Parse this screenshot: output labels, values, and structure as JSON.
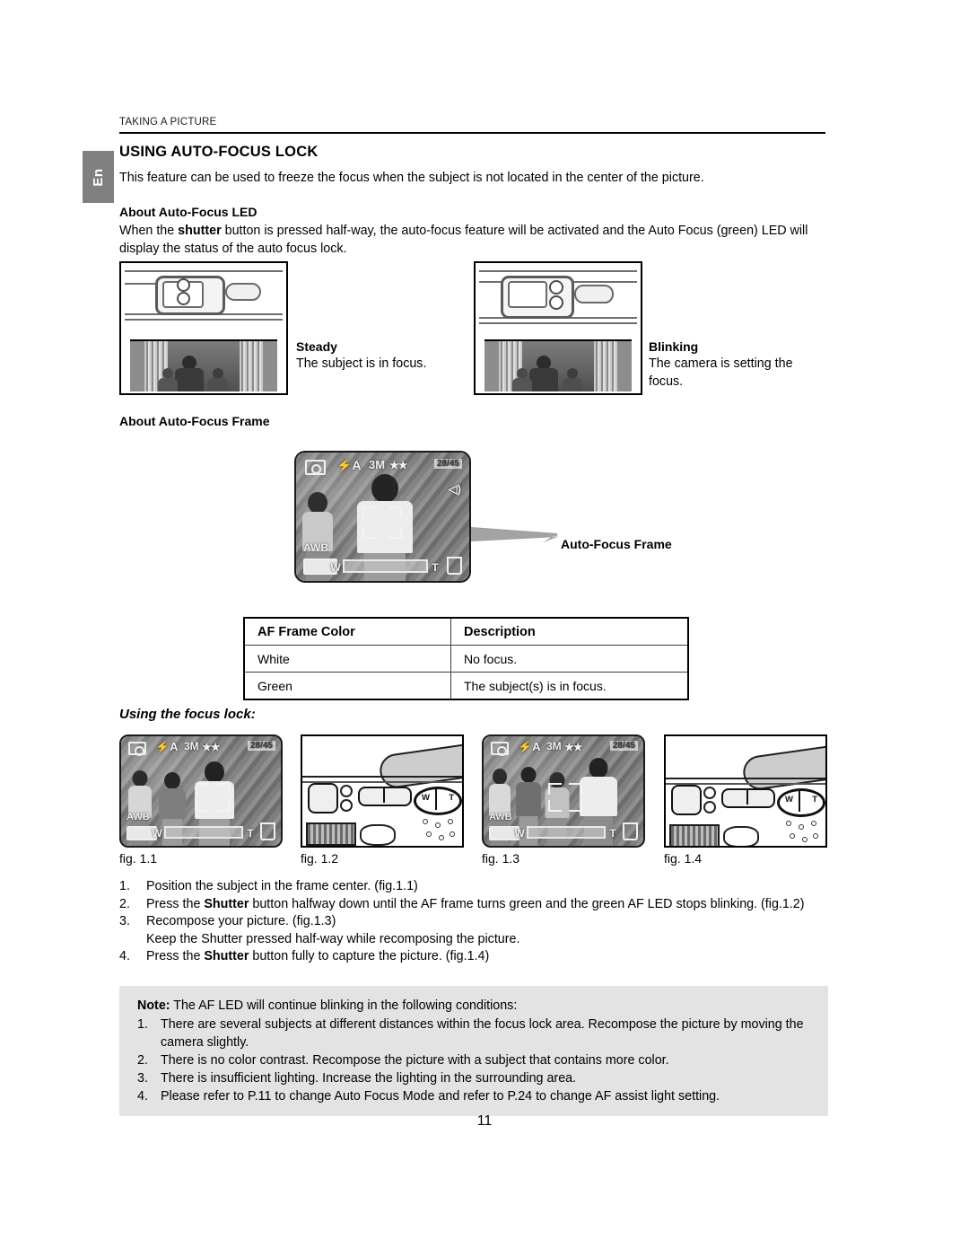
{
  "document": {
    "running_head": "TAKING A PICTURE",
    "language_tab": "En",
    "page_number": "11"
  },
  "section": {
    "title": "USING AUTO-FOCUS LOCK",
    "intro": "This feature can be used to freeze the focus when the subject is not located in the center of the picture."
  },
  "about_led": {
    "heading": "About Auto-Focus LED",
    "body_prefix": "When the ",
    "body_bold": "shutter",
    "body_suffix": " button is pressed half-way, the auto-focus feature will be activated and the Auto Focus (green) LED will display the status of the auto focus lock."
  },
  "led_states": [
    {
      "title": "Steady",
      "text": "The subject is in focus."
    },
    {
      "title": "Blinking",
      "text": "The camera is setting the focus."
    }
  ],
  "about_frame": {
    "heading": "About Auto-Focus Frame",
    "callout_label": "Auto-Focus Frame"
  },
  "lcd_osd": {
    "camera_icon": "camera-mode-icon",
    "flash": "⚡A",
    "resolution": "3M",
    "quality_stars": "★★",
    "counter": "28/45",
    "speaker_icon": "speaker-icon",
    "white_balance": "AWB",
    "battery_icon": "battery-icon",
    "zoom_wide": "W",
    "zoom_tele": "T",
    "card_icon": "memory-card-icon"
  },
  "af_table": {
    "headers": [
      "AF Frame Color",
      "Description"
    ],
    "rows": [
      [
        "White",
        "No focus."
      ],
      [
        "Green",
        "The subject(s) is in focus."
      ]
    ]
  },
  "focus_lock": {
    "heading": "Using the focus lock:",
    "figures": [
      {
        "caption": "fig. 1.1"
      },
      {
        "caption": "fig. 1.2"
      },
      {
        "caption": "fig. 1.3"
      },
      {
        "caption": "fig. 1.4"
      }
    ],
    "steps": [
      {
        "num": "1.",
        "text": "Position the subject in the frame center. (fig.1.1)"
      },
      {
        "num": "2.",
        "prefix": "Press the ",
        "bold": "Shutter",
        "suffix": " button halfway down until the AF frame turns green and the green AF LED stops blinking. (fig.1.2)"
      },
      {
        "num": "3.",
        "text": "Recompose your picture. (fig.1.3)",
        "sub": "Keep the Shutter pressed half-way while recomposing the picture."
      },
      {
        "num": "4.",
        "prefix": "Press the ",
        "bold": "Shutter",
        "suffix": " button fully to capture the picture. (fig.1.4)"
      }
    ]
  },
  "note": {
    "label": "Note:",
    "lead": " The AF LED will continue blinking in the following conditions:",
    "items": [
      {
        "num": "1.",
        "text": "There are several subjects at different distances within the focus lock area. Recompose the picture by moving the camera slightly."
      },
      {
        "num": "2.",
        "text": "There is no color contrast. Recompose the picture with a subject that contains more color."
      },
      {
        "num": "3.",
        "text": "There is insufficient lighting. Increase the lighting in the surrounding area."
      },
      {
        "num": "4.",
        "text": "Please refer to P.11 to change Auto Focus Mode and refer to P.24 to change AF assist light setting."
      }
    ]
  },
  "colors": {
    "tab_gray": "#808080",
    "note_bg": "#e3e3e3",
    "rule": "#000000"
  }
}
